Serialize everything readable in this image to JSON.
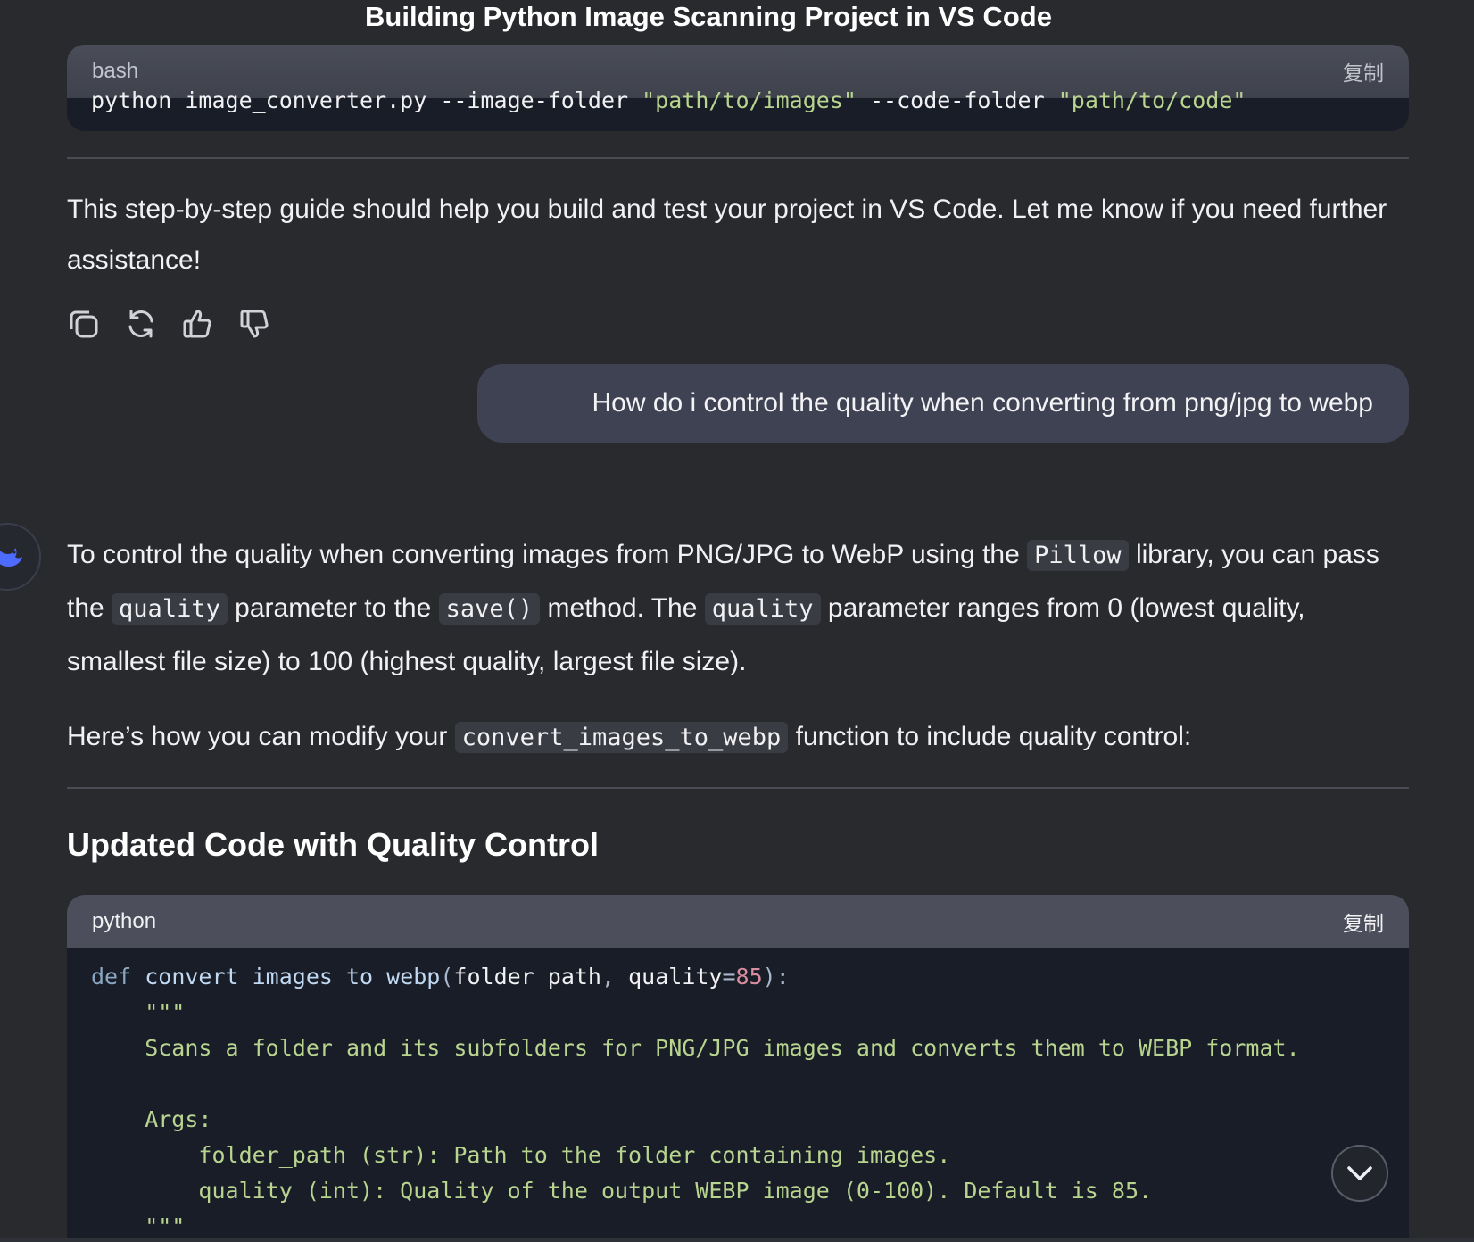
{
  "page": {
    "title": "Building Python Image Scanning Project in VS Code"
  },
  "bash_block": {
    "language": "bash",
    "copy_label": "复制",
    "line_plain1": "python image_converter.py --image-folder ",
    "line_str1": "\"path/to/images\"",
    "line_plain2": " --code-folder ",
    "line_str2": "\"path/to/code\""
  },
  "closing_paragraph": "This step-by-step guide should help you build and test your project in VS Code. Let me know if you need further assistance!",
  "actions": [
    {
      "icon": "copy-icon"
    },
    {
      "icon": "regenerate-icon"
    },
    {
      "icon": "thumbs-up-icon"
    },
    {
      "icon": "thumbs-down-icon"
    }
  ],
  "user_message": "How do i control the quality when converting from png/jpg to webp",
  "assistant_reply": {
    "p1_a": "To control the quality when converting images from PNG/JPG to WebP using the ",
    "p1_code1": "Pillow",
    "p1_b": " library, you can pass the ",
    "p1_code2": "quality",
    "p1_c": " parameter to the ",
    "p1_code3": "save()",
    "p1_d": " method. The ",
    "p1_code4": "quality",
    "p1_e": " parameter ranges from 0 (lowest quality, smallest file size) to 100 (highest quality, largest file size).",
    "p2_a": "Here’s how you can modify your ",
    "p2_code": "convert_images_to_webp",
    "p2_b": " function to include quality control:",
    "heading": "Updated Code with Quality Control"
  },
  "python_block": {
    "language": "python",
    "copy_label": "复制",
    "def_kw": "def",
    "fn_name": "convert_images_to_webp",
    "open_paren": "(",
    "param1": "folder_path",
    "comma": ", ",
    "param2": "quality",
    "eq": "=",
    "default_val": "85",
    "close": "):",
    "docstring_open": "    \"\"\"",
    "doc_line1": "    Scans a folder and its subfolders for PNG/JPG images and converts them to WEBP format.",
    "doc_blank": " ",
    "doc_args": "    Args:",
    "doc_arg1": "        folder_path (str): Path to the folder containing images.",
    "doc_arg2": "        quality (int): Quality of the output WEBP image (0-100). Default is 85.",
    "docstring_close": "    \"\"\""
  },
  "colors": {
    "background": "#292a2d",
    "code_background": "#181d28",
    "code_header": "#4c4f5b",
    "user_bubble": "#3f4252",
    "string": "#b8d48f",
    "keyword": "#8aa6c1",
    "number": "#d98e9e",
    "avatar_accent": "#4d6bfe"
  },
  "scroll_button_icon": "chevron-down-icon",
  "avatar_icon": "deepseek-whale-icon"
}
